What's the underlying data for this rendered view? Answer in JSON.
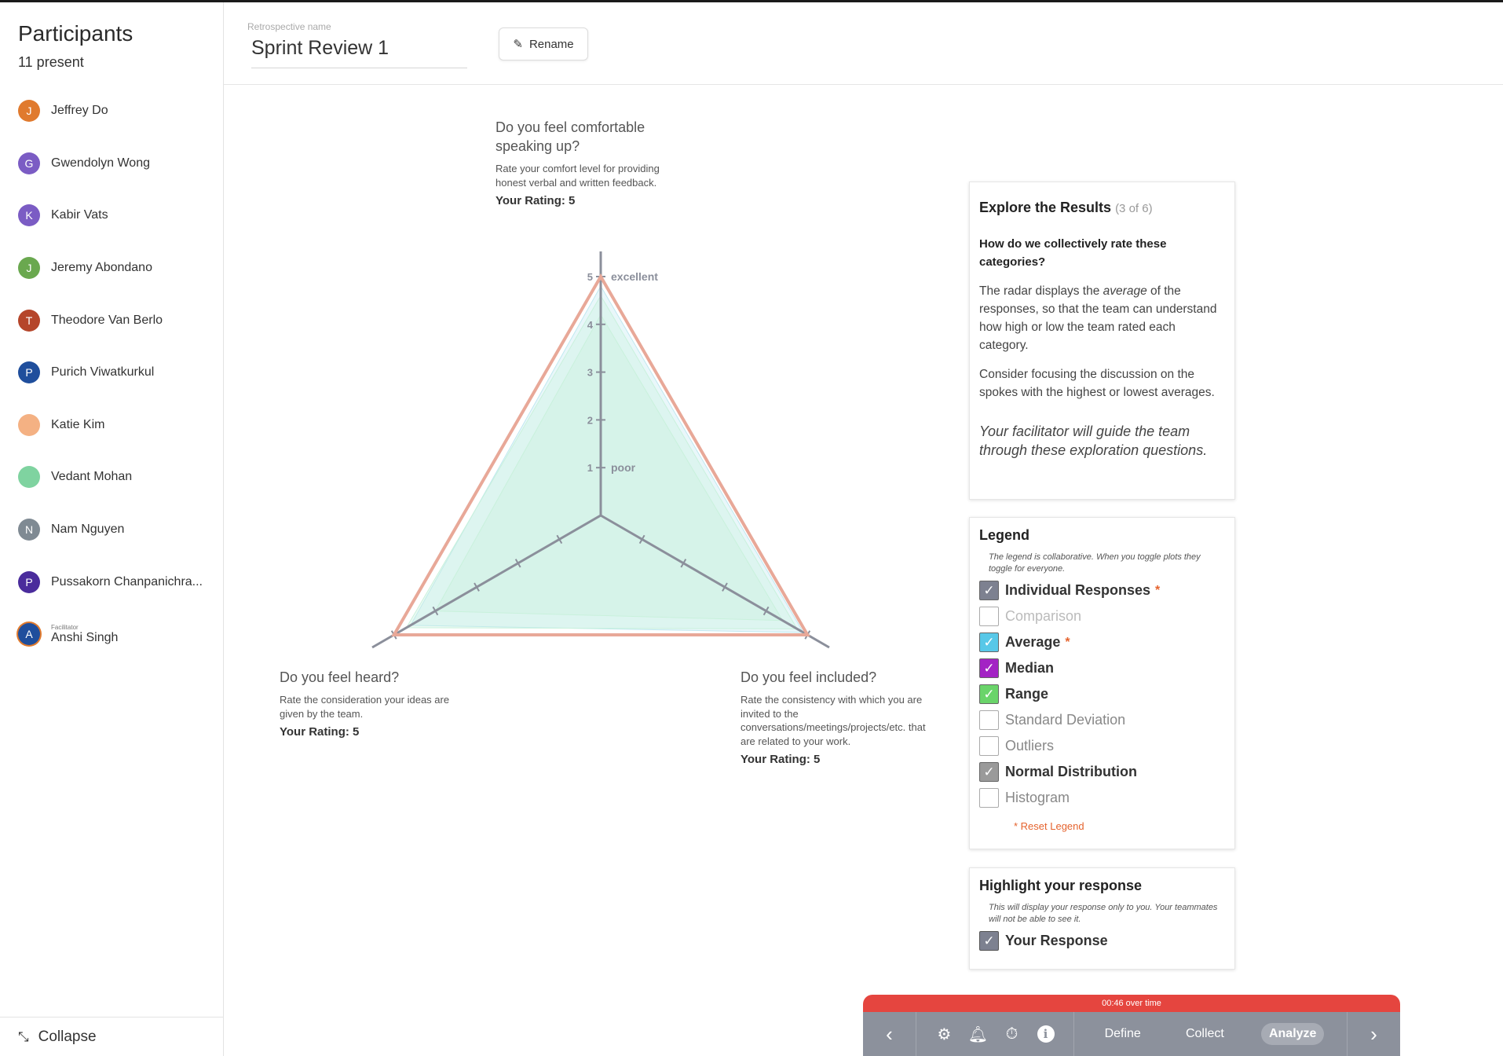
{
  "sidebar": {
    "title": "Participants",
    "count": "11 present",
    "participants": [
      {
        "initial": "J",
        "name": "Jeffrey Do",
        "color": "#e07a2e"
      },
      {
        "initial": "G",
        "name": "Gwendolyn Wong",
        "color": "#7b5cc4"
      },
      {
        "initial": "K",
        "name": "Kabir Vats",
        "color": "#7b5cc4"
      },
      {
        "initial": "J",
        "name": "Jeremy Abondano",
        "color": "#6aa84f"
      },
      {
        "initial": "T",
        "name": "Theodore Van Berlo",
        "color": "#b5452a"
      },
      {
        "initial": "P",
        "name": "Purich Viwatkurkul",
        "color": "#1f4e9c"
      },
      {
        "initial": "",
        "name": "Katie Kim",
        "color": "#f4b183"
      },
      {
        "initial": "",
        "name": "Vedant Mohan",
        "color": "#7fd3a0"
      },
      {
        "initial": "N",
        "name": "Nam Nguyen",
        "color": "#7f8a93"
      },
      {
        "initial": "P",
        "name": "Pussakorn Chanpanichra...",
        "color": "#4a2c9c"
      },
      {
        "initial": "A",
        "name": "Anshi Singh",
        "color": "#1f4e9c",
        "role": "Facilitator"
      }
    ],
    "collapse_label": "Collapse"
  },
  "header": {
    "retro_label": "Retrospective name",
    "retro_name": "Sprint Review 1",
    "rename_label": "Rename"
  },
  "questions": {
    "q1": {
      "title": "Do you feel comfortable speaking up?",
      "desc": "Rate your comfort level for providing honest verbal and written feedback.",
      "rating": "Your Rating: 5"
    },
    "q2": {
      "title": "Do you feel heard?",
      "desc": "Rate the consideration your ideas are given by the team.",
      "rating": "Your Rating: 5"
    },
    "q3": {
      "title": "Do you feel included?",
      "desc": "Rate the consistency with which you are invited to the conversations/meetings/projects/etc. that are related to your work.",
      "rating": "Your Rating: 5"
    }
  },
  "chart_data": {
    "type": "radar",
    "axes": [
      "Do you feel comfortable speaking up?",
      "Do you feel heard?",
      "Do you feel included?"
    ],
    "scale": [
      1,
      5
    ],
    "tick_labels": [
      "1",
      "2",
      "3",
      "4",
      "5"
    ],
    "scale_words": {
      "1": "poor",
      "5": "excellent"
    },
    "series": [
      {
        "values": [
          5,
          5,
          5
        ],
        "color": "#e8a898"
      },
      {
        "values": [
          4.6,
          4.7,
          4.75
        ],
        "color": "#c9f1dc"
      },
      {
        "values": [
          4.2,
          4.0,
          4.4
        ],
        "color": "#c9f1dc"
      },
      {
        "values": [
          4.8,
          4.6,
          4.9
        ],
        "color": "#bfe8f0"
      }
    ]
  },
  "explore": {
    "title": "Explore the Results",
    "step": "(3 of 6)",
    "question": "How do we collectively rate these categories?",
    "p1_a": "The radar displays the ",
    "p1_em": "average",
    "p1_b": " of the responses, so that the team can understand how high or low the team rated each category.",
    "p2": "Consider focusing the discussion on the spokes with the highest or lowest averages.",
    "facilitator_note": "Your facilitator will guide the team through these exploration questions."
  },
  "legend": {
    "title": "Legend",
    "note": "The legend is collaborative. When you toggle plots they toggle for everyone.",
    "items": [
      {
        "label": "Individual Responses",
        "checked": true,
        "color": "#7d8190",
        "star": "*"
      },
      {
        "label": "Comparison",
        "checked": false,
        "color": "#ffffff",
        "star": ""
      },
      {
        "label": "Average",
        "checked": true,
        "color": "#58c8e8",
        "star": "*"
      },
      {
        "label": "Median",
        "checked": true,
        "color": "#a323c4",
        "star": ""
      },
      {
        "label": "Range",
        "checked": true,
        "color": "#6ad46a",
        "star": ""
      },
      {
        "label": "Standard Deviation",
        "checked": false,
        "color": "#ffffff",
        "star": ""
      },
      {
        "label": "Outliers",
        "checked": false,
        "color": "#ffffff",
        "star": ""
      },
      {
        "label": "Normal Distribution",
        "checked": true,
        "color": "#9a9a9a",
        "star": ""
      },
      {
        "label": "Histogram",
        "checked": false,
        "color": "#ffffff",
        "star": ""
      }
    ],
    "reset_label": "* Reset Legend"
  },
  "highlight": {
    "title": "Highlight your response",
    "note": "This will display your response only to you. Your teammates will not be able to see it.",
    "item_label": "Your Response"
  },
  "bottombar": {
    "timer": "00:46 over time",
    "phases": [
      "Define",
      "Collect",
      "Analyze"
    ],
    "active_phase": "Analyze"
  }
}
